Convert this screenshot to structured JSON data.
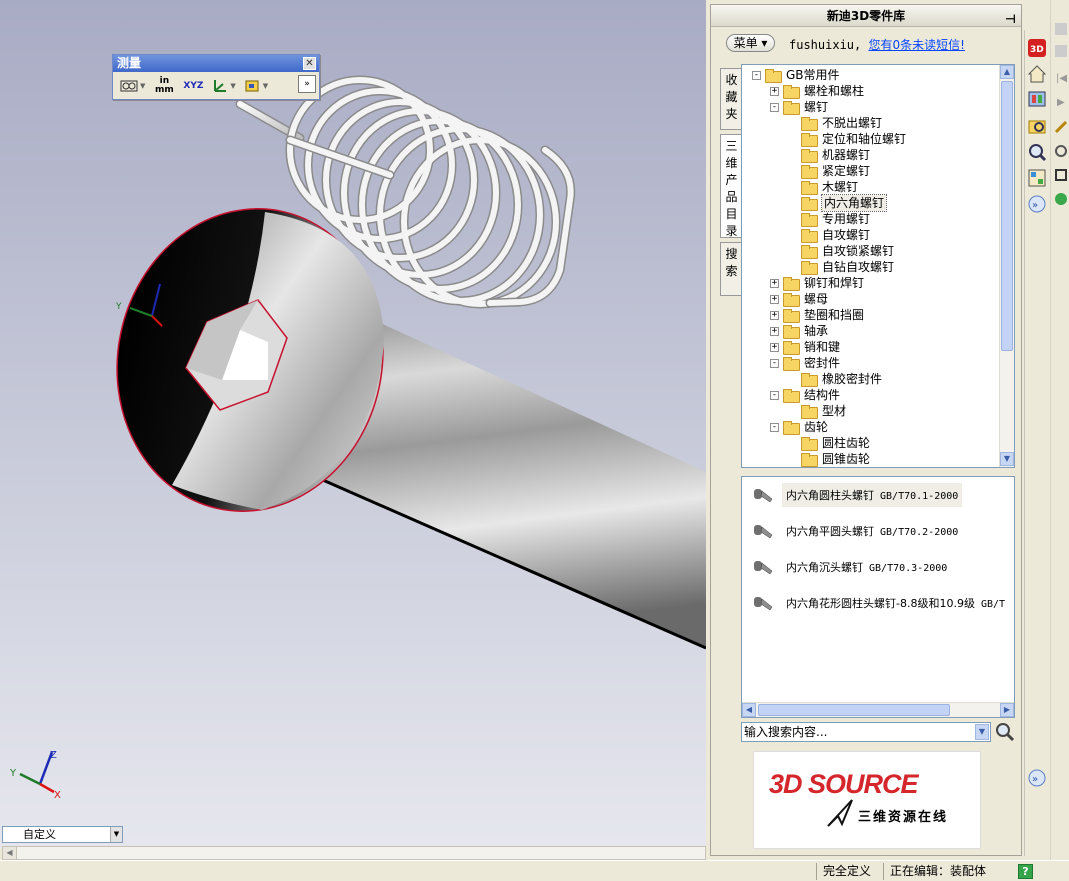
{
  "measure_toolbar": {
    "title": "测量",
    "close": "✕",
    "units_label": "in mm",
    "xyz_label": "XYZ",
    "expand": "»"
  },
  "viewport": {
    "config_combo": "自定义"
  },
  "library": {
    "title": "新迪3D零件库",
    "menu_label": "菜单",
    "username": "fushuixiu,",
    "message_link": "您有0条未读短信!",
    "tabs": [
      "收藏夹",
      "三维产品目录",
      "搜索"
    ],
    "tree": [
      {
        "label": "GB常用件",
        "level": 0,
        "exp": "-"
      },
      {
        "label": "螺栓和螺柱",
        "level": 1,
        "exp": "+"
      },
      {
        "label": "螺钉",
        "level": 1,
        "exp": "-"
      },
      {
        "label": "不脱出螺钉",
        "level": 2,
        "exp": ""
      },
      {
        "label": "定位和轴位螺钉",
        "level": 2,
        "exp": ""
      },
      {
        "label": "机器螺钉",
        "level": 2,
        "exp": ""
      },
      {
        "label": "紧定螺钉",
        "level": 2,
        "exp": ""
      },
      {
        "label": "木螺钉",
        "level": 2,
        "exp": ""
      },
      {
        "label": "内六角螺钉",
        "level": 2,
        "exp": "",
        "selected": true
      },
      {
        "label": "专用螺钉",
        "level": 2,
        "exp": ""
      },
      {
        "label": "自攻螺钉",
        "level": 2,
        "exp": ""
      },
      {
        "label": "自攻锁紧螺钉",
        "level": 2,
        "exp": ""
      },
      {
        "label": "自钻自攻螺钉",
        "level": 2,
        "exp": ""
      },
      {
        "label": "铆钉和焊钉",
        "level": 1,
        "exp": "+"
      },
      {
        "label": "螺母",
        "level": 1,
        "exp": "+"
      },
      {
        "label": "垫圈和挡圈",
        "level": 1,
        "exp": "+"
      },
      {
        "label": "轴承",
        "level": 1,
        "exp": "+"
      },
      {
        "label": "销和键",
        "level": 1,
        "exp": "+"
      },
      {
        "label": "密封件",
        "level": 1,
        "exp": "-"
      },
      {
        "label": "橡胶密封件",
        "level": 2,
        "exp": ""
      },
      {
        "label": "结构件",
        "level": 1,
        "exp": "-"
      },
      {
        "label": "型材",
        "level": 2,
        "exp": ""
      },
      {
        "label": "齿轮",
        "level": 1,
        "exp": "-"
      },
      {
        "label": "圆柱齿轮",
        "level": 2,
        "exp": ""
      },
      {
        "label": "圆锥齿轮",
        "level": 2,
        "exp": ""
      }
    ],
    "results": [
      {
        "name": "内六角圆柱头螺钉",
        "std": "GB/T70.1-2000",
        "selected": true
      },
      {
        "name": "内六角平圆头螺钉",
        "std": "GB/T70.2-2000"
      },
      {
        "name": "内六角沉头螺钉",
        "std": "GB/T70.3-2000"
      },
      {
        "name": "内六角花形圆柱头螺钉-8.8级和10.9级",
        "std": "GB/T"
      }
    ],
    "search_placeholder": "输入搜索内容...",
    "banner_main": "3D SOURCE",
    "banner_sub": "三维资源在线"
  },
  "status": {
    "definition": "完全定义",
    "editing": "正在编辑：装配体",
    "help": "?"
  }
}
